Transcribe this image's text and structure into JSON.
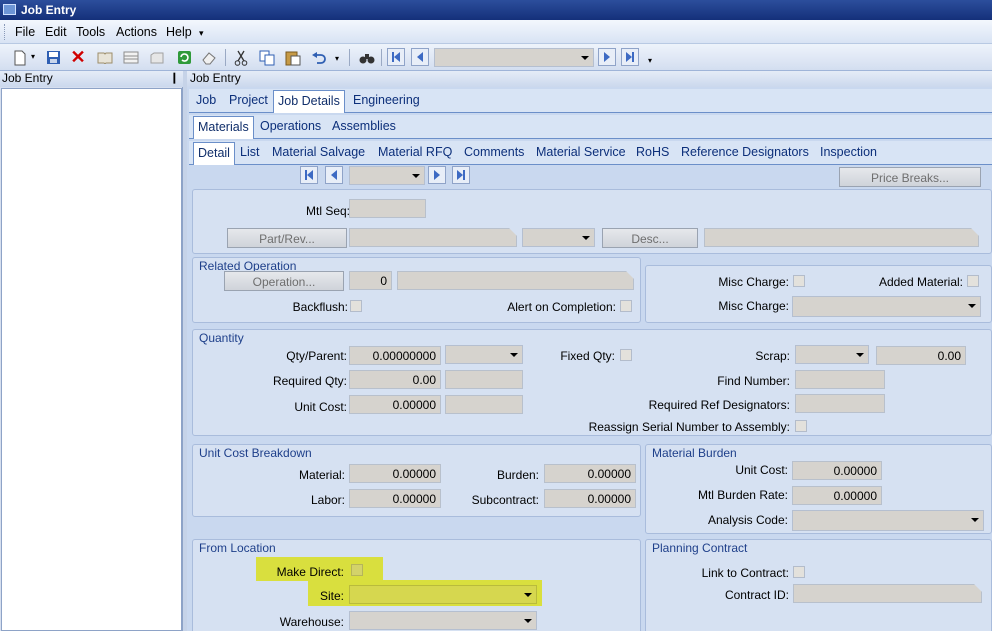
{
  "window": {
    "title": "Job Entry"
  },
  "menu": [
    "File",
    "Edit",
    "Tools",
    "Actions",
    "Help"
  ],
  "toolbar": {
    "icons": [
      "new-icon",
      "save-icon",
      "delete-icon",
      "book-icon",
      "grid-icon",
      "blank-icon",
      "refresh-icon",
      "eraser-icon",
      "cut-icon",
      "copy-icon",
      "paste-icon",
      "undo-icon",
      "binoculars-icon"
    ],
    "colors": {
      "accent": "#3d6ac3",
      "highlight": "#d9df3e",
      "titlebar": "#1a3a86"
    }
  },
  "left_panel": {
    "title": "Job Entry",
    "pin_glyph": "❙"
  },
  "main": {
    "title": "Job Entry",
    "tabs1": [
      "Job",
      "Project",
      "Job Details",
      "Engineering"
    ],
    "tabs1_active": "Job Details",
    "tabs2": [
      "Materials",
      "Operations",
      "Assemblies"
    ],
    "tabs2_active": "Materials",
    "tabs3": [
      "Detail",
      "List",
      "Material Salvage",
      "Material RFQ",
      "Comments",
      "Material Service",
      "RoHS",
      "Reference Designators",
      "Inspection"
    ],
    "tabs3_active": "Detail",
    "price_breaks": "Price Breaks...",
    "header": {
      "mtl_seq_label": "Mtl Seq:",
      "part_rev_btn": "Part/Rev...",
      "desc_btn": "Desc..."
    },
    "related_operation": {
      "title": "Related Operation",
      "operation_btn": "Operation...",
      "operation_value": "0",
      "backflush_label": "Backflush:",
      "alert_label": "Alert on Completion:"
    },
    "misc": {
      "misc_charge_check_label": "Misc Charge:",
      "added_material_label": "Added Material:",
      "misc_charge_combo_label": "Misc Charge:"
    },
    "quantity": {
      "title": "Quantity",
      "qty_parent_label": "Qty/Parent:",
      "qty_parent_value": "0.00000000",
      "required_qty_label": "Required Qty:",
      "required_qty_value": "0.00",
      "unit_cost_label": "Unit Cost:",
      "unit_cost_value": "0.00000",
      "fixed_qty_label": "Fixed Qty:",
      "scrap_label": "Scrap:",
      "scrap_value": "0.00",
      "find_number_label": "Find Number:",
      "req_ref_label": "Required Ref Designators:",
      "reassign_label": "Reassign Serial Number to Assembly:"
    },
    "unit_cost_breakdown": {
      "title": "Unit Cost Breakdown",
      "material_label": "Material:",
      "material_value": "0.00000",
      "burden_label": "Burden:",
      "burden_value": "0.00000",
      "labor_label": "Labor:",
      "labor_value": "0.00000",
      "subcontract_label": "Subcontract:",
      "subcontract_value": "0.00000"
    },
    "material_burden": {
      "title": "Material Burden",
      "unit_cost_label": "Unit Cost:",
      "unit_cost_value": "0.00000",
      "burden_rate_label": "Mtl  Burden Rate:",
      "burden_rate_value": "0.00000",
      "analysis_code_label": "Analysis Code:"
    },
    "from_location": {
      "title": "From Location",
      "make_direct_label": "Make Direct:",
      "site_label": "Site:",
      "warehouse_label": "Warehouse:"
    },
    "planning_contract": {
      "title": "Planning Contract",
      "link_label": "Link to Contract:",
      "contract_id_label": "Contract ID:"
    }
  }
}
